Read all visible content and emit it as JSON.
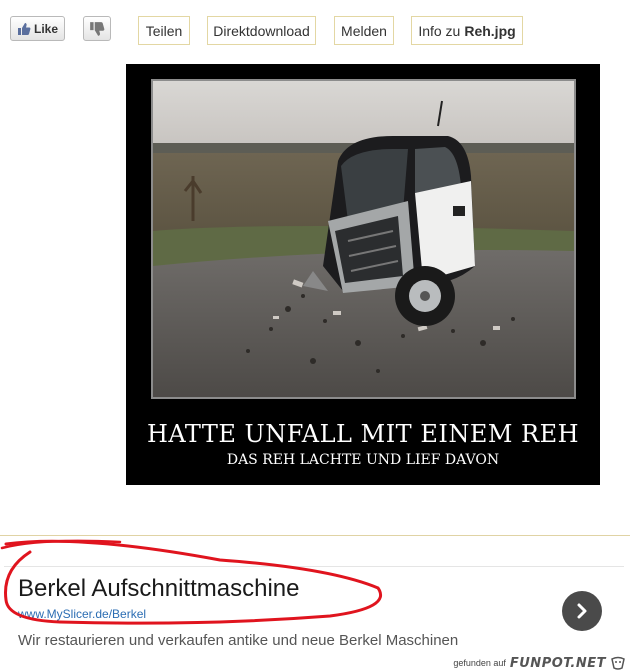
{
  "toolbar": {
    "like_label": "Like",
    "share_label": "Teilen",
    "download_label": "Direktdownload",
    "report_label": "Melden",
    "info_prefix": "Info zu",
    "info_filename": "Reh.jpg"
  },
  "poster": {
    "title": "HATTE UNFALL MIT EINEM REH",
    "subtitle": "DAS REH LACHTE UND LIEF DAVON"
  },
  "ad": {
    "title": "Berkel Aufschnittmaschine",
    "url": "www.MySlicer.de/Berkel",
    "description": "Wir restaurieren und verkaufen antike und neue Berkel Maschinen"
  },
  "watermark": {
    "prefix": "gefunden auf",
    "brand": "FUNPOT.NET"
  },
  "colors": {
    "button_border": "#e3d7a3",
    "ad_url": "#2b6db3",
    "scribble": "#e0141e",
    "poster_bg": "#000000"
  },
  "icons": [
    "thumbs-up-icon",
    "thumbs-down-icon",
    "chevron-right-icon",
    "photo",
    "red-scribble"
  ]
}
